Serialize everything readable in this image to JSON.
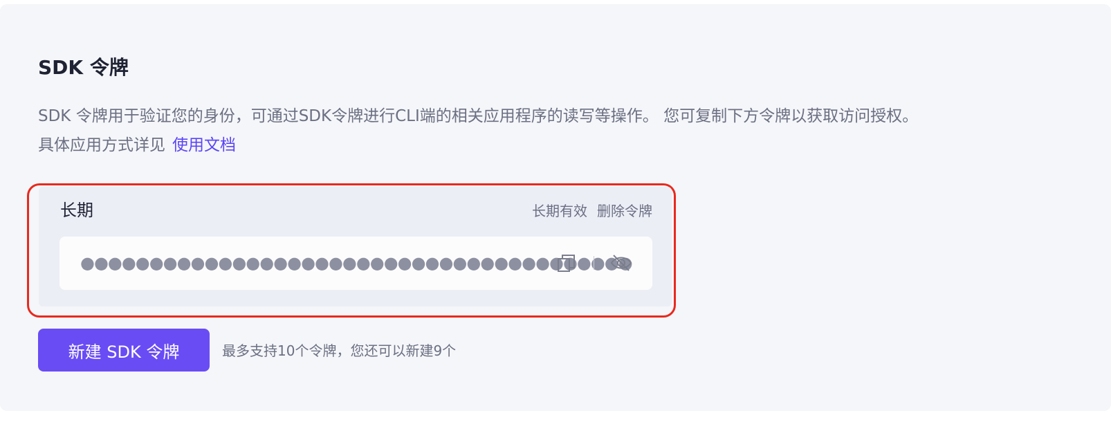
{
  "section": {
    "title": "SDK 令牌",
    "description_line1": "SDK 令牌用于验证您的身份，可通过SDK令牌进行CLI端的相关应用程序的读写等操作。 您可复制下方令牌以获取访问授权。",
    "description_line2": "具体应用方式详见",
    "doc_link": "使用文档"
  },
  "token": {
    "name": "长期",
    "validity": "长期有效",
    "delete_label": "删除令牌",
    "masked_value": "●●●●●●●●●●●●●●●●●●●●●●●●●●●●●●●●●●●●●●●●",
    "copy_icon": "copy-icon",
    "visibility_icon": "eye-off-icon"
  },
  "actions": {
    "new_token_label": "新建 SDK 令牌",
    "limit_hint": "最多支持10个令牌，您还可以新建9个"
  },
  "colors": {
    "accent": "#6a4cf5",
    "link": "#5b45f5",
    "highlight_border": "#e8291d"
  }
}
